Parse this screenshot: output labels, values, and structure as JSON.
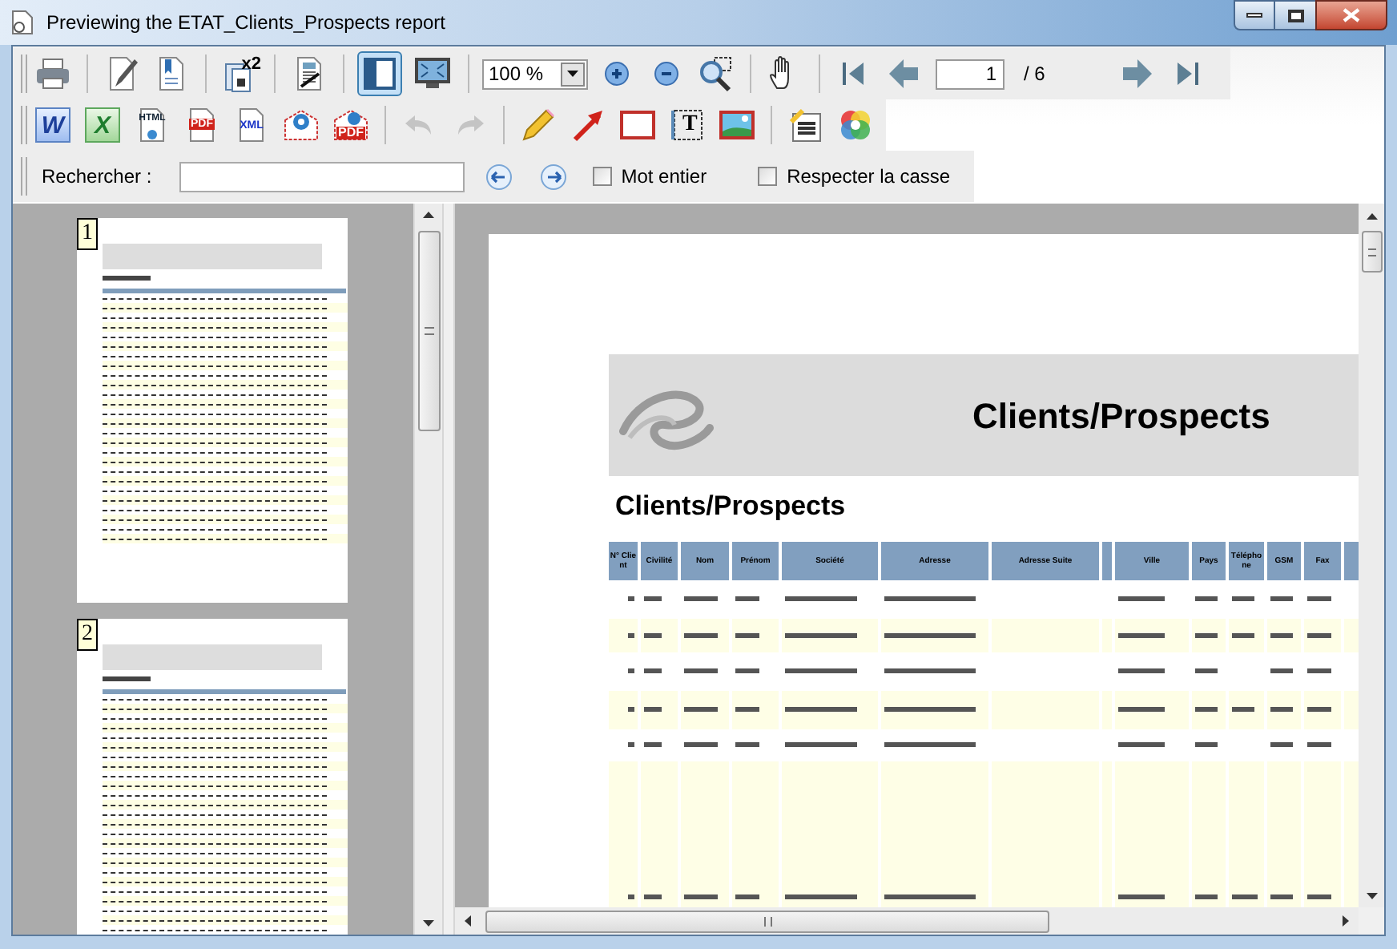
{
  "window": {
    "title": "Previewing the ETAT_Clients_Prospects report"
  },
  "toolbar_rows": [
    {
      "groups": [
        {
          "items": [
            {
              "kind": "print"
            }
          ]
        },
        {
          "items": [
            {
              "kind": "edit"
            },
            {
              "kind": "bookmark"
            }
          ]
        },
        {
          "items": [
            {
              "kind": "copies",
              "label": "x2"
            }
          ]
        },
        {
          "items": [
            {
              "kind": "page-setup"
            }
          ]
        },
        {
          "items": [
            {
              "kind": "thumbnails",
              "pressed": true
            },
            {
              "kind": "fullscreen",
              "pressed": false
            }
          ]
        },
        {
          "items": [
            {
              "kind": "zoom-combo",
              "value": "100 %"
            },
            {
              "kind": "zoom-in"
            },
            {
              "kind": "zoom-out"
            },
            {
              "kind": "zoom-area"
            }
          ]
        },
        {
          "items": [
            {
              "kind": "hand"
            }
          ]
        },
        {
          "items": [
            {
              "kind": "first"
            },
            {
              "kind": "prev"
            },
            {
              "kind": "page-field",
              "value": "1"
            },
            {
              "kind": "page-count",
              "label": "/ 6"
            },
            {
              "kind": "next"
            },
            {
              "kind": "last"
            }
          ]
        }
      ]
    },
    {
      "groups": [
        {
          "items": [
            {
              "kind": "word",
              "label": "W"
            },
            {
              "kind": "excel",
              "label": "X"
            },
            {
              "kind": "html",
              "label": "HTML"
            },
            {
              "kind": "pdf",
              "label": "PDF"
            },
            {
              "kind": "xml",
              "label": "XML"
            },
            {
              "kind": "mail"
            },
            {
              "kind": "mail-pdf",
              "label": "PDF"
            }
          ]
        },
        {
          "items": [
            {
              "kind": "undo",
              "disabled": true
            },
            {
              "kind": "redo",
              "disabled": true
            }
          ]
        },
        {
          "items": [
            {
              "kind": "pencil"
            },
            {
              "kind": "arrow"
            },
            {
              "kind": "rectangle"
            },
            {
              "kind": "text",
              "label": "T"
            },
            {
              "kind": "image"
            }
          ]
        },
        {
          "items": [
            {
              "kind": "form"
            },
            {
              "kind": "colors"
            }
          ]
        }
      ]
    }
  ],
  "search": {
    "label": "Rechercher :",
    "options": [
      {
        "label": "Mot entier",
        "checked": false
      },
      {
        "label": "Respecter la casse",
        "checked": false
      }
    ]
  },
  "thumbnails": [
    {
      "number": "1"
    },
    {
      "number": "2"
    }
  ],
  "report": {
    "title": "Clients/Prospects",
    "subtitle": "Clients/Prospects",
    "columns": [
      {
        "label": "N° Client"
      },
      {
        "label": "Civilité"
      },
      {
        "label": "Nom"
      },
      {
        "label": "Prénom"
      },
      {
        "label": "Société"
      },
      {
        "label": "Adresse"
      },
      {
        "label": "Adresse Suite"
      },
      {
        "label": "Ville"
      },
      {
        "label": "Pays"
      },
      {
        "label": "Téléphone"
      },
      {
        "label": "GSM"
      },
      {
        "label": "Fax"
      }
    ]
  }
}
